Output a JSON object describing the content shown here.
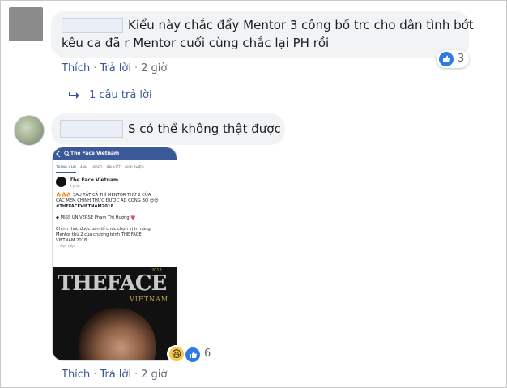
{
  "comment1": {
    "text_line1": "Kiểu này chắc đẩy Mentor 3 công bố trc cho dân tình bớt",
    "text_line2": "kêu ca đã r Mentor cuối cùng chắc lại PH rồi",
    "reaction_count": "3",
    "action_like": "Thích",
    "action_reply": "Trả lời",
    "time": "2 giờ",
    "replies_label": "1 câu trả lời"
  },
  "comment2": {
    "text": "S có thể không thật được",
    "reaction_count": "6",
    "action_like": "Thích",
    "action_reply": "Trả lời",
    "time": "2 giờ"
  },
  "embedded_post": {
    "search_text": "The Face Vietnam",
    "tabs": [
      "TRANG CHỦ",
      "ẢNH",
      "VIDEO",
      "BÀI VIẾT",
      "GIỚI THIỆU"
    ],
    "page_name": "The Face Vietnam",
    "post_time": "3 phút",
    "line1": "🔥🔥🔥 SAU TẤT CẢ THÌ MENTOR THỨ 2 CỦA",
    "line2": "CÁC MEM CHÍNH THỨC ĐƯỢC AD CÔNG BỐ 😍😍",
    "hashtag": "#THEFACEVIETNAM2018",
    "miss": "◆ MISS UNIVERSE Phạm Thị Hương 💗",
    "line3": "Chính thức được ban tổ chức chọn vị trí nóng",
    "line4": "Mentor thứ 2 của chương trình THE FACE",
    "line5": "VIETNAM 2018",
    "read_more": "... Đọc tiếp",
    "image_brand": "THEFACE",
    "image_subbrand": "VIETNAM",
    "image_year": "2018"
  },
  "colors": {
    "bubble": "#f2f3f5",
    "link": "#385898",
    "like_blue": "#2e7be6"
  }
}
